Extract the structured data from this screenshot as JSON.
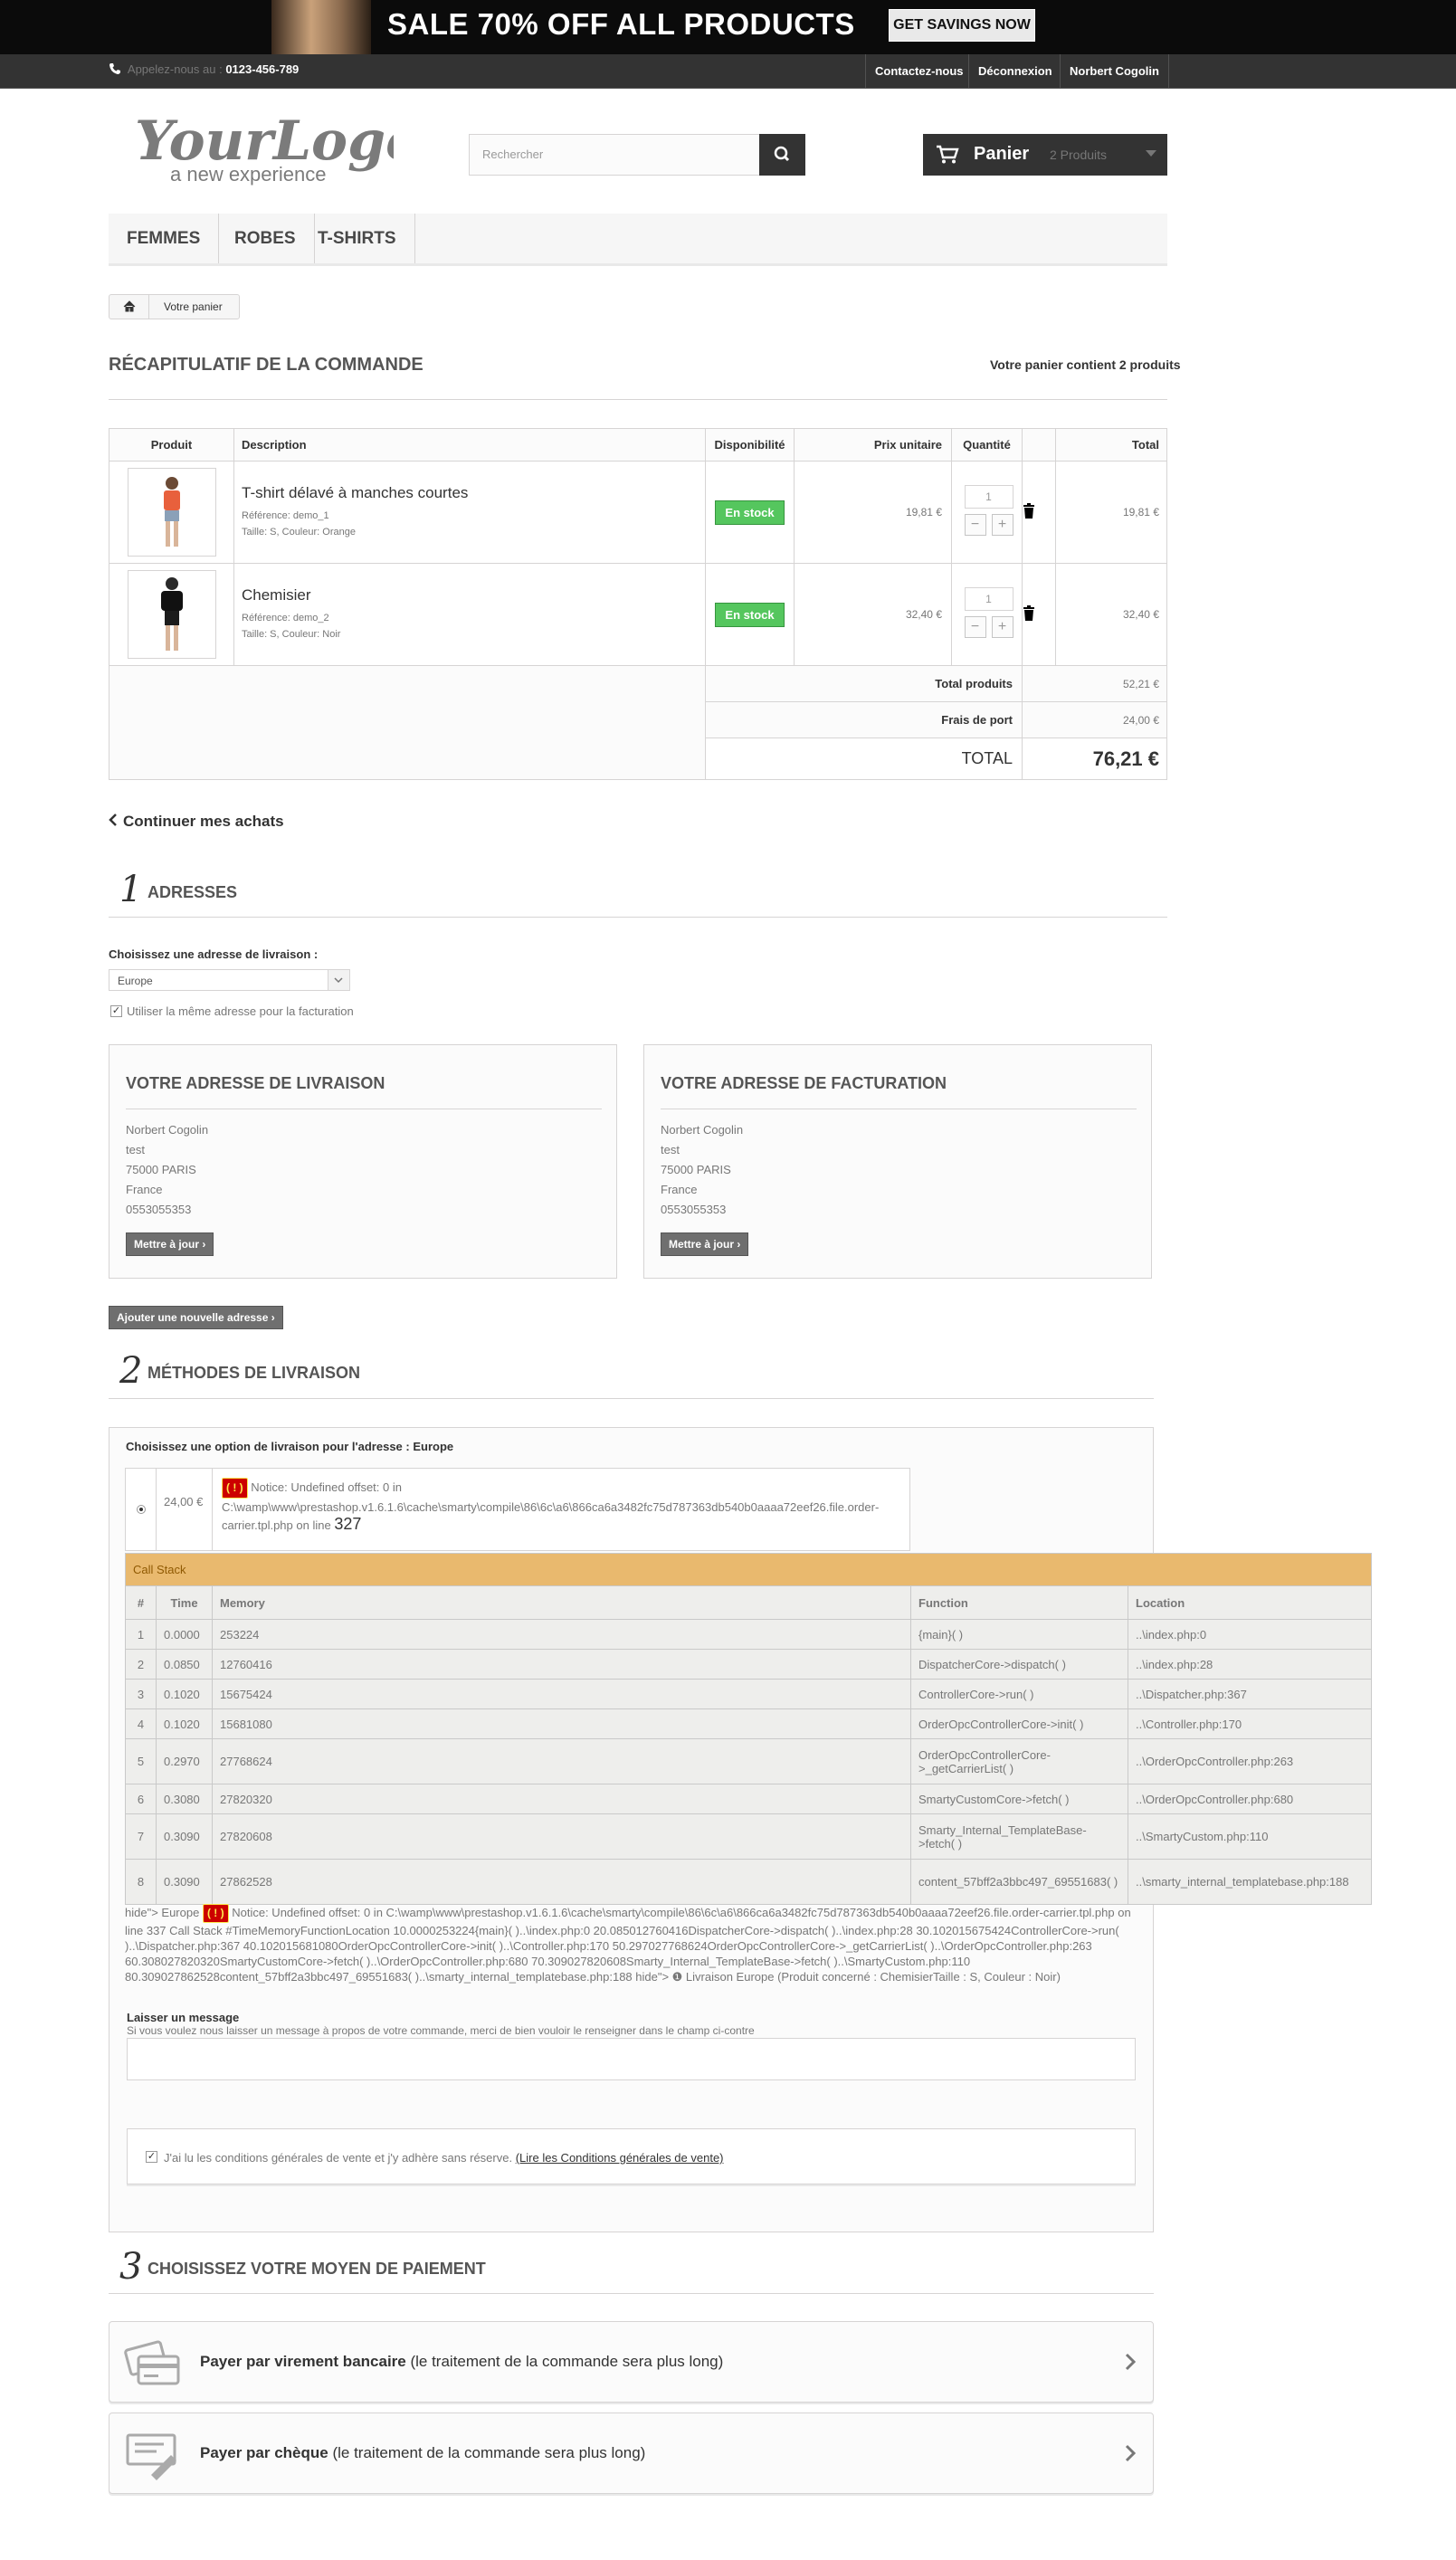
{
  "banner": {
    "text": "SALE 70% OFF ALL PRODUCTS",
    "button": "GET SAVINGS NOW"
  },
  "topbar": {
    "call_label": "Appelez-nous au :",
    "phone": "0123-456-789",
    "contact": "Contactez-nous",
    "logout": "Déconnexion",
    "user": "Norbert Cogolin"
  },
  "logo": {
    "main": "YourLogo",
    "tagline": "a new experience"
  },
  "search": {
    "placeholder": "Rechercher"
  },
  "cart": {
    "label": "Panier",
    "count": "2 Produits"
  },
  "menu": [
    "FEMMES",
    "ROBES",
    "T-SHIRTS"
  ],
  "breadcrumb": {
    "current": "Votre panier"
  },
  "summary": {
    "title": "RÉCAPITULATIF DE LA COMMANDE",
    "cart_info": "Votre panier contient 2 produits"
  },
  "table": {
    "headers": [
      "Produit",
      "Description",
      "Disponibilité",
      "Prix unitaire",
      "Quantité",
      "",
      "Total"
    ],
    "rows": [
      {
        "name": "T-shirt délavé à manches courtes",
        "ref": "Référence: demo_1",
        "attrs": "Taille: S, Couleur: Orange",
        "stock": "En stock",
        "price": "19,81 €",
        "qty": "1",
        "total": "19,81 €"
      },
      {
        "name": "Chemisier",
        "ref": "Référence: demo_2",
        "attrs": "Taille: S, Couleur: Noir",
        "stock": "En stock",
        "price": "32,40 €",
        "qty": "1",
        "total": "32,40 €"
      }
    ],
    "total_products_label": "Total produits",
    "total_products": "52,21 €",
    "shipping_label": "Frais de port",
    "shipping": "24,00 €",
    "total_label": "TOTAL",
    "total": "76,21 €"
  },
  "continue": "Continuer mes achats",
  "step1": {
    "num": "1",
    "title": "ADRESSES",
    "choose_label": "Choisissez une adresse de livraison :",
    "selected": "Europe",
    "same_address": "Utiliser la même adresse pour la facturation",
    "delivery": {
      "title": "VOTRE ADRESSE DE LIVRAISON",
      "lines": [
        "Norbert Cogolin",
        "test",
        "75000 PARIS",
        "France",
        "0553055353"
      ],
      "btn": "Mettre à jour"
    },
    "invoice": {
      "title": "VOTRE ADRESSE DE FACTURATION",
      "lines": [
        "Norbert Cogolin",
        "test",
        "75000 PARIS",
        "France",
        "0553055353"
      ],
      "btn": "Mettre à jour"
    },
    "add_btn": "Ajouter une nouvelle adresse"
  },
  "step2": {
    "num": "2",
    "title": "MÉTHODES DE LIVRAISON",
    "choose": "Choisissez une option de livraison pour l'adresse : Europe",
    "price": "24,00 €",
    "error_badge": "( ! )",
    "notice": "Notice: Undefined offset: 0 in C:\\wamp\\www\\prestashop.v1.6.1.6\\cache\\smarty\\compile\\86\\6c\\a6\\866ca6a3482fc75d787363db540b0aaaa72eef26.file.order-carrier.tpl.php on line",
    "line": "327",
    "callstack": "Call Stack",
    "cs_headers": [
      "#",
      "Time",
      "Memory",
      "Function",
      "Location"
    ],
    "cs_rows": [
      [
        "1",
        "0.0000",
        "253224",
        "{main}( )",
        "..\\index.php:0"
      ],
      [
        "2",
        "0.0850",
        "12760416",
        "DispatcherCore->dispatch( )",
        "..\\index.php:28"
      ],
      [
        "3",
        "0.1020",
        "15675424",
        "ControllerCore->run( )",
        "..\\Dispatcher.php:367"
      ],
      [
        "4",
        "0.1020",
        "15681080",
        "OrderOpcControllerCore->init( )",
        "..\\Controller.php:170"
      ],
      [
        "5",
        "0.2970",
        "27768624",
        "OrderOpcControllerCore->_getCarrierList( )",
        "..\\OrderOpcController.php:263"
      ],
      [
        "6",
        "0.3080",
        "27820320",
        "SmartyCustomCore->fetch( )",
        "..\\OrderOpcController.php:680"
      ],
      [
        "7",
        "0.3090",
        "27820608",
        "Smarty_Internal_TemplateBase->fetch( )",
        "..\\SmartyCustom.php:110"
      ],
      [
        "8",
        "0.3090",
        "27862528",
        "content_57bff2a3bbc497_69551683( )",
        "..\\smarty_internal_templatebase.php:188"
      ]
    ],
    "notice2_pre": "hide\"> Europe",
    "notice2": "Notice: Undefined offset: 0 in C:\\wamp\\www\\prestashop.v1.6.1.6\\cache\\smarty\\compile\\86\\6c\\a6\\866ca6a3482fc75d787363db540b0aaaa72eef26.file.order-carrier.tpl.php on line 337 Call Stack #TimeMemoryFunctionLocation 10.0000253224{main}( )..\\index.php:0 20.085012760416DispatcherCore->dispatch( )..\\index.php:28 30.102015675424ControllerCore->run( )..\\Dispatcher.php:367 40.102015681080OrderOpcControllerCore->init( )..\\Controller.php:170 50.297027768624OrderOpcControllerCore->_getCarrierList( )..\\OrderOpcController.php:263 60.308027820320SmartyCustomCore->fetch( )..\\OrderOpcController.php:680 70.309027820608Smarty_Internal_TemplateBase->fetch( )..\\SmartyCustom.php:110 80.309027862528content_57bff2a3bbc497_69551683( )..\\smarty_internal_templatebase.php:188 hide\"> ❶ Livraison Europe (Produit concerné : ChemisierTaille : S, Couleur : Noir)",
    "message_title": "Laisser un message",
    "message_hint": "Si vous voulez nous laisser un message à propos de votre commande, merci de bien vouloir le renseigner dans le champ ci-contre",
    "cgv": "J'ai lu les conditions générales de vente et j'y adhère sans réserve.",
    "cgv_link": "(Lire les Conditions générales de vente)"
  },
  "step3": {
    "num": "3",
    "title": "CHOISISSEZ VOTRE MOYEN DE PAIEMENT",
    "bank": {
      "bold": "Payer par virement bancaire",
      "rest": " (le traitement de la commande sera plus long)"
    },
    "cheque": {
      "bold": "Payer par chèque",
      "rest": " (le traitement de la commande sera plus long)"
    }
  },
  "colors": {
    "topbar": "#333333",
    "stock": "#55c65e",
    "callstack": "#e9b96e",
    "error": "#cc0000"
  }
}
